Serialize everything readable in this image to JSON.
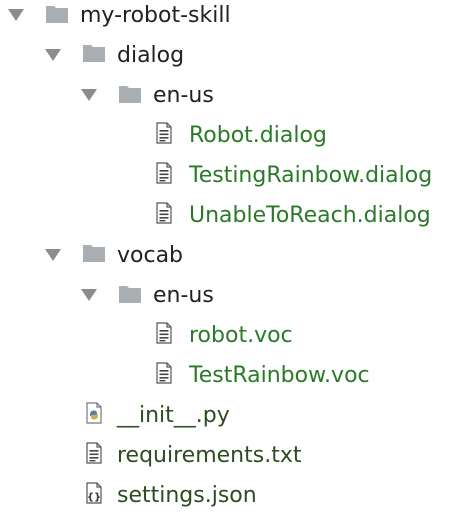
{
  "colors": {
    "folder": "#a9aeb2",
    "arrow": "#8c8c8c",
    "text_folder": "#222222",
    "text_file_green": "#2a7a28",
    "text_file_dark": "#2b4d1f",
    "python_blue": "#5b7fa6",
    "python_yellow": "#c9b348"
  },
  "tree": {
    "root": {
      "label": "my-robot-skill",
      "icon": "folder-icon",
      "expanded": true
    },
    "dialog": {
      "label": "dialog",
      "icon": "folder-icon",
      "expanded": true
    },
    "dialog_en_us": {
      "label": "en-us",
      "icon": "folder-icon",
      "expanded": true
    },
    "dialog_files": [
      {
        "label": "Robot.dialog",
        "icon": "text-file-icon"
      },
      {
        "label": "TestingRainbow.dialog",
        "icon": "text-file-icon"
      },
      {
        "label": "UnableToReach.dialog",
        "icon": "text-file-icon"
      }
    ],
    "vocab": {
      "label": "vocab",
      "icon": "folder-icon",
      "expanded": true
    },
    "vocab_en_us": {
      "label": "en-us",
      "icon": "folder-icon",
      "expanded": true
    },
    "vocab_files": [
      {
        "label": "robot.voc",
        "icon": "text-file-icon"
      },
      {
        "label": "TestRainbow.voc",
        "icon": "text-file-icon"
      }
    ],
    "root_files": [
      {
        "label": "__init__.py",
        "icon": "python-file-icon"
      },
      {
        "label": "requirements.txt",
        "icon": "text-file-icon"
      },
      {
        "label": "settings.json",
        "icon": "json-file-icon"
      }
    ]
  }
}
